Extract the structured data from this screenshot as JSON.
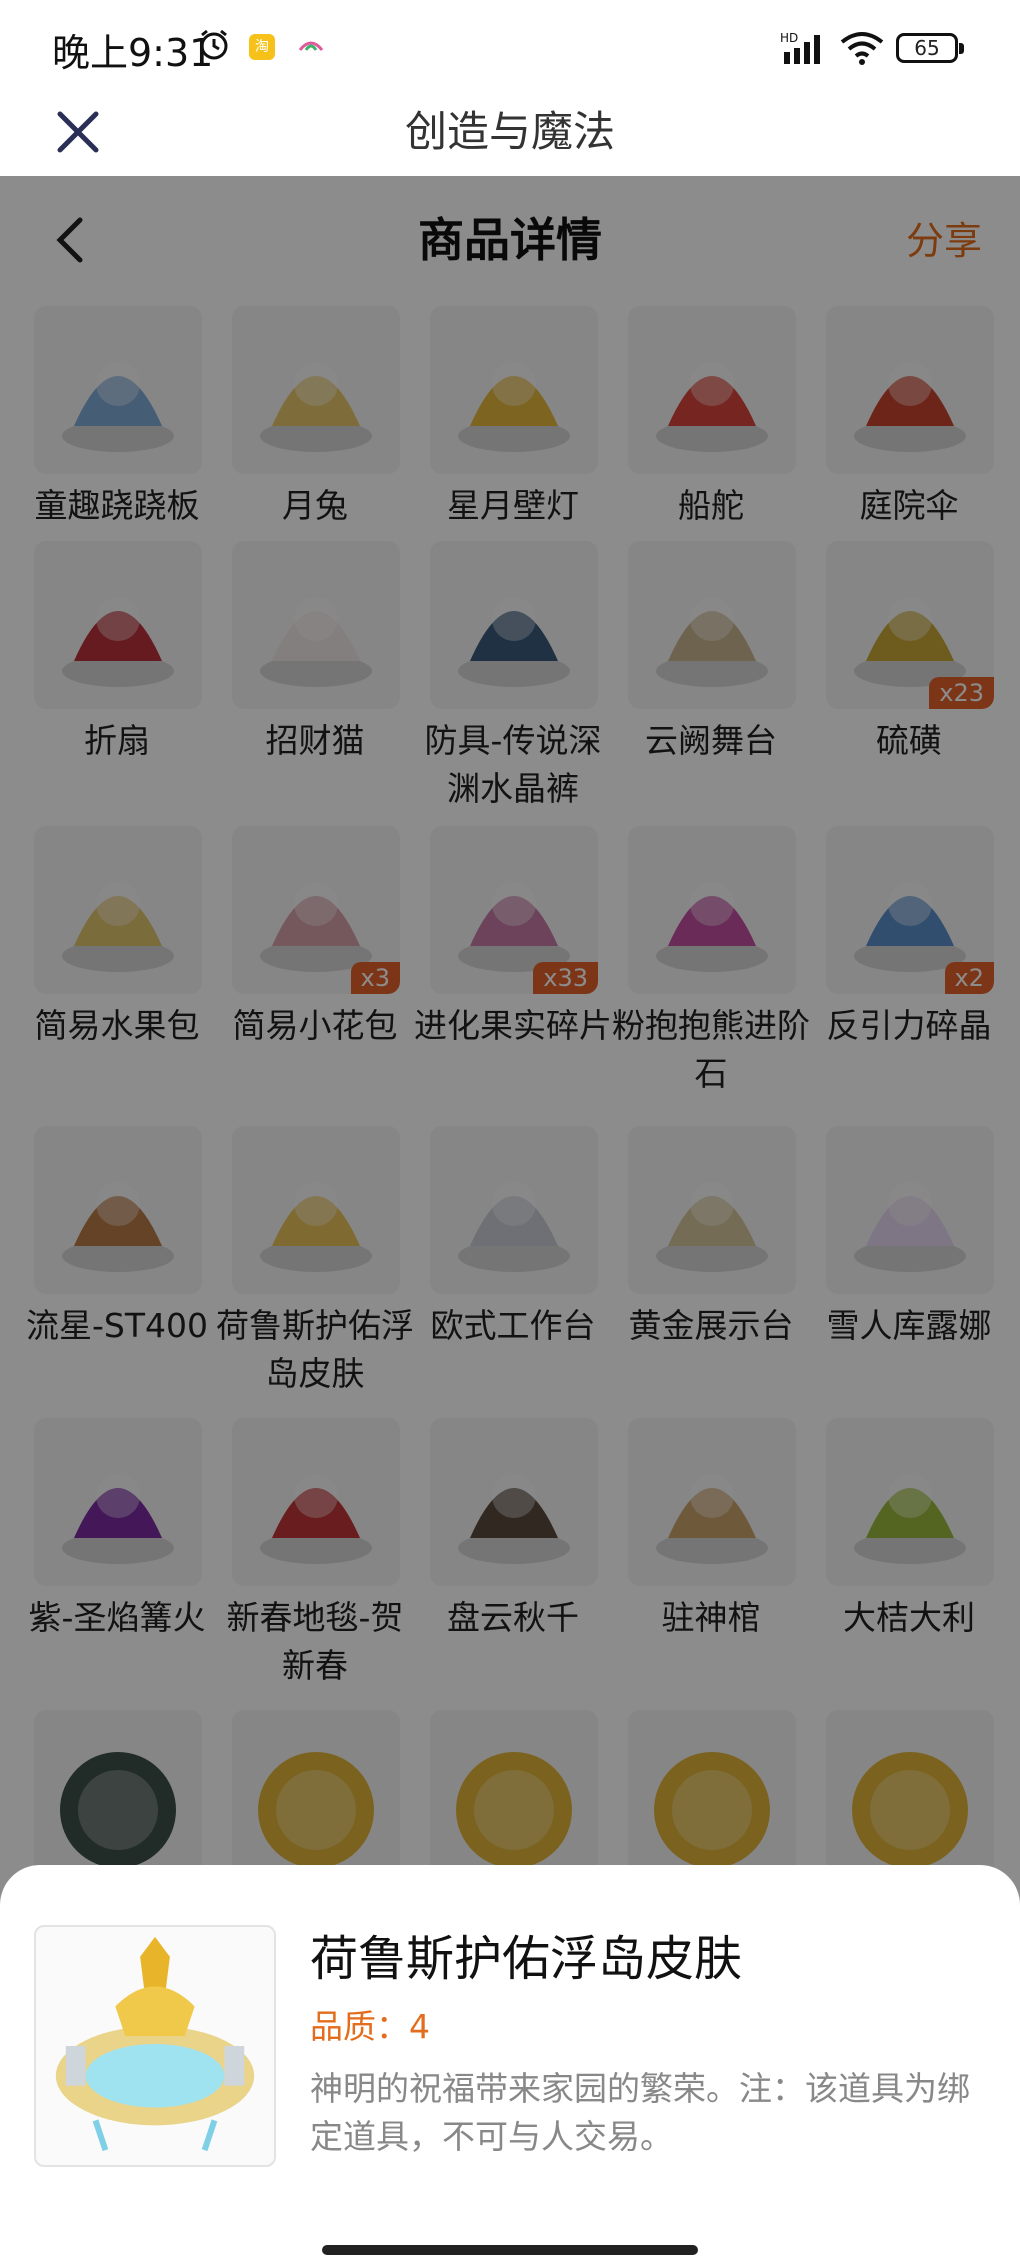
{
  "status_bar": {
    "time": "晚上9:31",
    "battery": "65",
    "signal_label": "HD"
  },
  "app_bar": {
    "title": "创造与魔法",
    "close_icon": "close-icon"
  },
  "header": {
    "title": "商品详情",
    "share": "分享",
    "back_icon": "chevron-left-icon"
  },
  "items": [
    {
      "name": "童趣跷跷板",
      "qty": ""
    },
    {
      "name": "月兔",
      "qty": ""
    },
    {
      "name": "星月壁灯",
      "qty": ""
    },
    {
      "name": "船舵",
      "qty": ""
    },
    {
      "name": "庭院伞",
      "qty": ""
    },
    {
      "name": "折扇",
      "qty": ""
    },
    {
      "name": "招财猫",
      "qty": ""
    },
    {
      "name": "防具-传说深渊水晶裤",
      "qty": ""
    },
    {
      "name": "云阙舞台",
      "qty": ""
    },
    {
      "name": "硫磺",
      "qty": "x23"
    },
    {
      "name": "简易水果包",
      "qty": ""
    },
    {
      "name": "简易小花包",
      "qty": "x3"
    },
    {
      "name": "进化果实碎片",
      "qty": "x33"
    },
    {
      "name": "粉抱抱熊进阶石",
      "qty": ""
    },
    {
      "name": "反引力碎晶",
      "qty": "x2"
    },
    {
      "name": "流星-ST400",
      "qty": ""
    },
    {
      "name": "荷鲁斯护佑浮岛皮肤",
      "qty": ""
    },
    {
      "name": "欧式工作台",
      "qty": ""
    },
    {
      "name": "黄金展示台",
      "qty": ""
    },
    {
      "name": "雪人库露娜",
      "qty": ""
    },
    {
      "name": "紫-圣焰篝火",
      "qty": ""
    },
    {
      "name": "新春地毯-贺新春",
      "qty": ""
    },
    {
      "name": "盘云秋千",
      "qty": ""
    },
    {
      "name": "驻神棺",
      "qty": ""
    },
    {
      "name": "大桔大利",
      "qty": ""
    }
  ],
  "partial_row": [
    {
      "icon": "lantern-icon",
      "qty": ""
    },
    {
      "icon": "shirt-icon",
      "qty": ""
    },
    {
      "icon": "bow-coin-icon",
      "qty": ""
    },
    {
      "icon": "chest-coin-icon",
      "qty": ""
    },
    {
      "icon": "emblem-coin-icon",
      "qty": ""
    }
  ],
  "sheet": {
    "name": "荷鲁斯护佑浮岛皮肤",
    "quality": "品质：4",
    "description": "神明的祝福带来家园的繁荣。注：该道具为绑定道具，不可与人交易。"
  },
  "colors": {
    "accent": "#e36d1d",
    "badge": "#e3622a"
  }
}
